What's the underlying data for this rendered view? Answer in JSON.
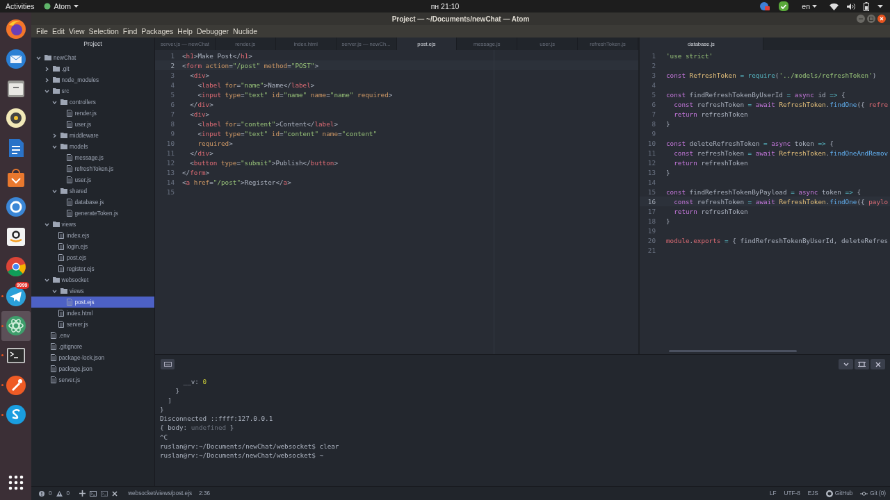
{
  "top_bar": {
    "activities": "Activities",
    "app_menu": "Atom",
    "clock": "пн 21:10",
    "language": "en"
  },
  "dock": [
    {
      "kind": "firefox",
      "running": false,
      "active": false
    },
    {
      "kind": "thunderbird",
      "running": false,
      "active": false
    },
    {
      "kind": "files",
      "running": false,
      "active": false
    },
    {
      "kind": "rhythmbox",
      "running": false,
      "active": false
    },
    {
      "kind": "writer",
      "running": false,
      "active": false
    },
    {
      "kind": "software",
      "running": false,
      "active": false
    },
    {
      "kind": "help",
      "running": false,
      "active": false
    },
    {
      "kind": "amazon",
      "running": false,
      "active": false
    },
    {
      "kind": "chrome",
      "running": false,
      "active": false
    },
    {
      "kind": "telegram",
      "running": true,
      "active": false,
      "badge": "9999"
    },
    {
      "kind": "atom",
      "running": true,
      "active": true
    },
    {
      "kind": "terminal",
      "running": true,
      "active": false
    },
    {
      "kind": "postman",
      "running": true,
      "active": false
    },
    {
      "kind": "skype",
      "running": true,
      "active": false
    },
    {
      "kind": "apps",
      "running": false,
      "active": false
    }
  ],
  "window": {
    "title": "Project — ~/Documents/newChat — Atom"
  },
  "menu": [
    "File",
    "Edit",
    "View",
    "Selection",
    "Find",
    "Packages",
    "Help",
    "Debugger",
    "Nuclide"
  ],
  "tree": {
    "header": "Project",
    "items": [
      {
        "label": "newChat",
        "kind": "folder",
        "expanded": true,
        "selected": false,
        "children": [
          {
            "label": ".git",
            "kind": "folder",
            "expanded": false,
            "selected": false
          },
          {
            "label": "node_modules",
            "kind": "folder",
            "expanded": false,
            "selected": false
          },
          {
            "label": "src",
            "kind": "folder",
            "expanded": true,
            "selected": false,
            "children": [
              {
                "label": "controllers",
                "kind": "folder",
                "expanded": true,
                "selected": false,
                "children": [
                  {
                    "label": "render.js",
                    "kind": "file",
                    "selected": false
                  },
                  {
                    "label": "user.js",
                    "kind": "file",
                    "selected": false
                  }
                ]
              },
              {
                "label": "middleware",
                "kind": "folder",
                "expanded": false,
                "selected": false
              },
              {
                "label": "models",
                "kind": "folder",
                "expanded": true,
                "selected": false,
                "children": [
                  {
                    "label": "message.js",
                    "kind": "file",
                    "selected": false
                  },
                  {
                    "label": "refreshToken.js",
                    "kind": "file",
                    "selected": false
                  },
                  {
                    "label": "user.js",
                    "kind": "file",
                    "selected": false
                  }
                ]
              },
              {
                "label": "shared",
                "kind": "folder",
                "expanded": true,
                "selected": false,
                "children": [
                  {
                    "label": "database.js",
                    "kind": "file",
                    "selected": false
                  },
                  {
                    "label": "generateToken.js",
                    "kind": "file",
                    "selected": false
                  }
                ]
              }
            ]
          },
          {
            "label": "views",
            "kind": "folder",
            "expanded": true,
            "selected": false,
            "children": [
              {
                "label": "index.ejs",
                "kind": "file",
                "selected": false
              },
              {
                "label": "login.ejs",
                "kind": "file",
                "selected": false
              },
              {
                "label": "post.ejs",
                "kind": "file",
                "selected": false
              },
              {
                "label": "register.ejs",
                "kind": "file",
                "selected": false
              }
            ]
          },
          {
            "label": "websocket",
            "kind": "folder",
            "expanded": true,
            "selected": false,
            "children": [
              {
                "label": "views",
                "kind": "folder",
                "expanded": true,
                "selected": false,
                "children": [
                  {
                    "label": "post.ejs",
                    "kind": "file",
                    "selected": true
                  }
                ]
              },
              {
                "label": "index.html",
                "kind": "file",
                "selected": false
              },
              {
                "label": "server.js",
                "kind": "file",
                "selected": false
              }
            ]
          },
          {
            "label": ".env",
            "kind": "file",
            "selected": false
          },
          {
            "label": ".gitignore",
            "kind": "file",
            "selected": false
          },
          {
            "label": "package-lock.json",
            "kind": "file",
            "selected": false
          },
          {
            "label": "package.json",
            "kind": "file",
            "selected": false
          },
          {
            "label": "server.js",
            "kind": "file",
            "selected": false
          }
        ]
      }
    ]
  },
  "left_pane": {
    "tabs": [
      {
        "label": "server.js — newChat",
        "selected": false
      },
      {
        "label": "render.js",
        "selected": false
      },
      {
        "label": "index.html",
        "selected": false
      },
      {
        "label": "server.js — newCh...",
        "selected": false
      },
      {
        "label": "post.ejs",
        "selected": true
      },
      {
        "label": "message.js",
        "selected": false
      },
      {
        "label": "user.js",
        "selected": false
      },
      {
        "label": "refreshToken.js",
        "selected": false
      }
    ],
    "lines": [
      {
        "num": "1",
        "cursor": false,
        "text": "<h1>Make Post</h1>"
      },
      {
        "num": "2",
        "cursor": true,
        "text": "<form action=\"/post\" method=\"POST\">"
      },
      {
        "num": "3",
        "cursor": false,
        "text": "  <div>"
      },
      {
        "num": "4",
        "cursor": false,
        "text": "    <label for=\"name\">Name</label>"
      },
      {
        "num": "5",
        "cursor": false,
        "text": "    <input type=\"text\" id=\"name\" name=\"name\" required>"
      },
      {
        "num": "6",
        "cursor": false,
        "text": "  </div>"
      },
      {
        "num": "7",
        "cursor": false,
        "text": "  <div>"
      },
      {
        "num": "8",
        "cursor": false,
        "text": "    <label for=\"content\">Content</label>"
      },
      {
        "num": "9",
        "cursor": false,
        "text": "    <input type=\"text\" id=\"content\" name=\"content\""
      },
      {
        "num": "10",
        "cursor": false,
        "text": "    required>"
      },
      {
        "num": "11",
        "cursor": false,
        "text": "  </div>"
      },
      {
        "num": "12",
        "cursor": false,
        "text": "  <button type=\"submit\">Publish</button>"
      },
      {
        "num": "13",
        "cursor": false,
        "text": "</form>"
      },
      {
        "num": "14",
        "cursor": false,
        "text": "<a href=\"/post\">Register</a>"
      },
      {
        "num": "15",
        "cursor": false
      }
    ]
  },
  "right_pane": {
    "tabs": [
      {
        "label": "database.js",
        "selected": true
      }
    ],
    "lines": [
      {
        "num": "1",
        "cursor": false,
        "text": "'use strict'"
      },
      {
        "num": "2",
        "cursor": false
      },
      {
        "num": "3",
        "cursor": false,
        "text": "const RefreshToken = require('../models/refreshToken')"
      },
      {
        "num": "4",
        "cursor": false
      },
      {
        "num": "5",
        "cursor": false,
        "text": "const findRefreshTokenByUserId = async id => {"
      },
      {
        "num": "6",
        "cursor": false,
        "text": "  const refreshToken = await RefreshToken.findOne({ refre"
      },
      {
        "num": "7",
        "cursor": false,
        "text": "  return refreshToken"
      },
      {
        "num": "8",
        "cursor": false,
        "text": "}"
      },
      {
        "num": "9",
        "cursor": false
      },
      {
        "num": "10",
        "cursor": false,
        "text": "const deleteRefreshToken = async token => {"
      },
      {
        "num": "11",
        "cursor": false,
        "text": "  const refreshToken = await RefreshToken.findOneAndRemov"
      },
      {
        "num": "12",
        "cursor": false,
        "text": "  return refreshToken"
      },
      {
        "num": "13",
        "cursor": false,
        "text": "}"
      },
      {
        "num": "14",
        "cursor": false
      },
      {
        "num": "15",
        "cursor": false,
        "text": "const findRefreshTokenByPayload = async token => {"
      },
      {
        "num": "16",
        "cursor": true,
        "text": "  const refreshToken = await RefreshToken.findOne({ paylo"
      },
      {
        "num": "17",
        "cursor": false,
        "text": "  return refreshToken"
      },
      {
        "num": "18",
        "cursor": false,
        "text": "}"
      },
      {
        "num": "19",
        "cursor": false
      },
      {
        "num": "20",
        "cursor": false,
        "text": "module.exports = { findRefreshTokenByUserId, deleteRefres"
      },
      {
        "num": "21",
        "cursor": false
      }
    ]
  },
  "terminal": {
    "lines": [
      "      __v: 0",
      "    }",
      "  ]",
      "}",
      "Disconnected ::ffff:127.0.0.1",
      "{ body: undefined }",
      "^C",
      "ruslan@rv:~/Documents/newChat/websocket$ clear",
      "ruslan@rv:~/Documents/newChat/websocket$ ~"
    ]
  },
  "status_bar": {
    "errors": "0",
    "warnings": "0",
    "file_path": "websocket/views/post.ejs",
    "cursor_position": "2:36",
    "line_ending": "LF",
    "encoding": "UTF-8",
    "grammar": "EJS",
    "github": "GitHub",
    "git": "Git (0)"
  }
}
